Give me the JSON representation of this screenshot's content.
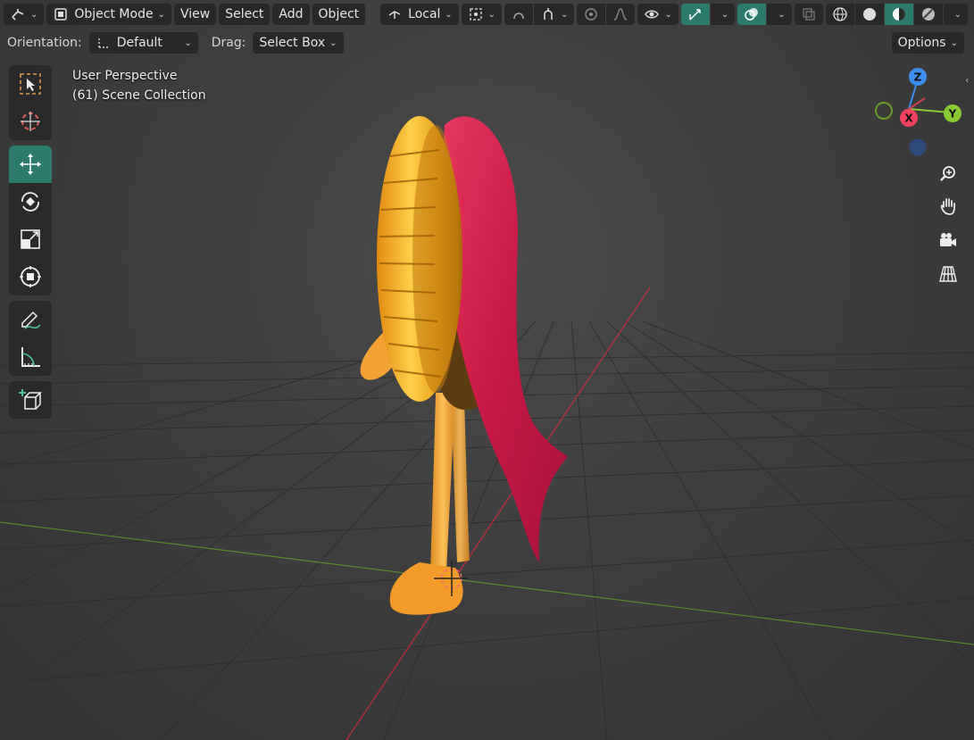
{
  "header": {
    "editor_type_icon": "view3d-icon",
    "mode": "Object Mode",
    "menus": [
      "View",
      "Select",
      "Add",
      "Object"
    ],
    "transform_orientation": "Local",
    "snap_icon": "snap-target-icon",
    "proportional_icon": "proportional-edit-icon",
    "visibility_icon": "eye-icon",
    "gizmo_icon": "gizmo-icon",
    "overlay_icon": "overlay-icon",
    "xray_icon": "xray-icon",
    "shading_modes": [
      "wireframe-icon",
      "solid-icon",
      "material-preview-icon",
      "rendered-icon"
    ],
    "active_shading": "material-preview-icon",
    "accent_color": "#2c7a6b"
  },
  "tool_settings": {
    "orientation_label": "Orientation:",
    "orientation_value": "Default",
    "drag_label": "Drag:",
    "drag_value": "Select Box",
    "options_label": "Options"
  },
  "viewport": {
    "view_name": "User Perspective",
    "collection": "(61) Scene Collection"
  },
  "toolbar": {
    "groups": [
      [
        "select-box-tool",
        "cursor-tool"
      ],
      [
        "move-tool",
        "rotate-tool",
        "scale-tool",
        "transform-tool"
      ],
      [
        "annotate-tool",
        "measure-tool"
      ],
      [
        "add-cube-tool"
      ]
    ],
    "active_tool": "move-tool"
  },
  "gizmo": {
    "axis_x": "X",
    "axis_y": "Y",
    "axis_z": "Z",
    "x_color": "#f0415e",
    "y_color": "#8bc932",
    "z_color": "#3d8dea"
  },
  "nav_buttons": [
    "zoom-icon",
    "hand-pan-icon",
    "camera-icon",
    "perspective-grid-icon"
  ]
}
